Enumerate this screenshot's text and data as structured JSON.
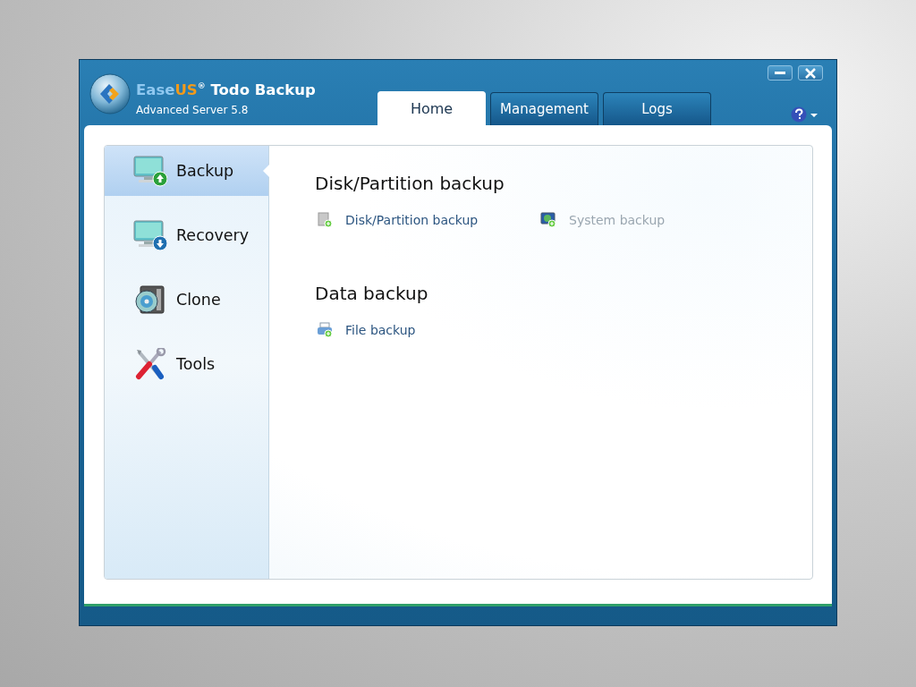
{
  "app": {
    "brand_first": "Ease",
    "brand_second": "US",
    "brand_mark": "®",
    "name": "Todo Backup",
    "edition": "Advanced Server 5.8"
  },
  "tabs": [
    {
      "label": "Home",
      "selected": true
    },
    {
      "label": "Management",
      "selected": false
    },
    {
      "label": "Logs",
      "selected": false
    }
  ],
  "sidebar": {
    "items": [
      {
        "label": "Backup",
        "kind": "backup",
        "selected": true
      },
      {
        "label": "Recovery",
        "kind": "recovery",
        "selected": false
      },
      {
        "label": "Clone",
        "kind": "clone",
        "selected": false
      },
      {
        "label": "Tools",
        "kind": "tools",
        "selected": false
      }
    ]
  },
  "sections": [
    {
      "title": "Disk/Partition backup",
      "links": [
        {
          "label": "Disk/Partition backup",
          "kind": "disk",
          "disabled": false
        },
        {
          "label": "System backup",
          "kind": "system",
          "disabled": true
        }
      ]
    },
    {
      "title": "Data backup",
      "links": [
        {
          "label": "File backup",
          "kind": "file",
          "disabled": false
        }
      ]
    }
  ]
}
